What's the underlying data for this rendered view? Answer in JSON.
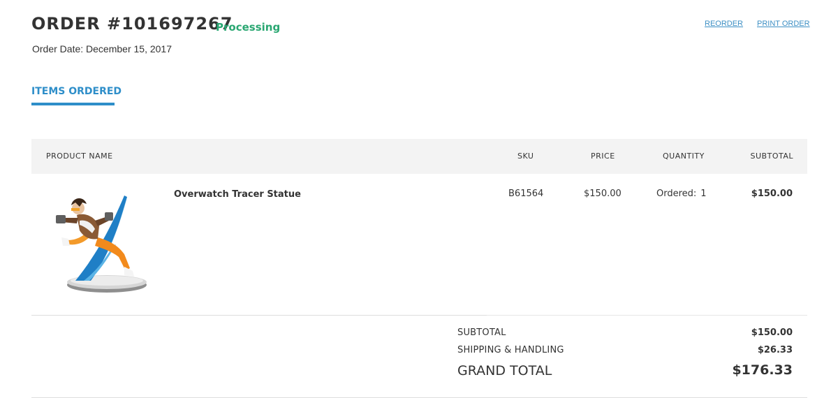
{
  "order": {
    "title": "ORDER #101697267",
    "status": "Processing",
    "date_line": "Order Date: December 15, 2017",
    "links": {
      "reorder": "REORDER",
      "print": "PRINT ORDER"
    }
  },
  "tabs": {
    "items_ordered": "ITEMS ORDERED"
  },
  "table": {
    "headers": {
      "product_name": "PRODUCT NAME",
      "sku": "SKU",
      "price": "PRICE",
      "quantity": "QUANTITY",
      "subtotal": "SUBTOTAL"
    },
    "rows": [
      {
        "name": "Overwatch Tracer Statue",
        "sku": "B61564",
        "price": "$150.00",
        "qty_label": "Ordered:",
        "qty_value": "1",
        "subtotal": "$150.00"
      }
    ]
  },
  "totals": {
    "subtotal_label": "SUBTOTAL",
    "subtotal_value": "$150.00",
    "shipping_label": "SHIPPING & HANDLING",
    "shipping_value": "$26.33",
    "grand_label": "GRAND TOTAL",
    "grand_value": "$176.33"
  },
  "colors": {
    "accent": "#2e8ec9",
    "status": "#2aa772",
    "link": "#3d8fc4",
    "header_bg": "#f3f3f3"
  },
  "icons": {
    "product": "tracer-statue-image"
  }
}
